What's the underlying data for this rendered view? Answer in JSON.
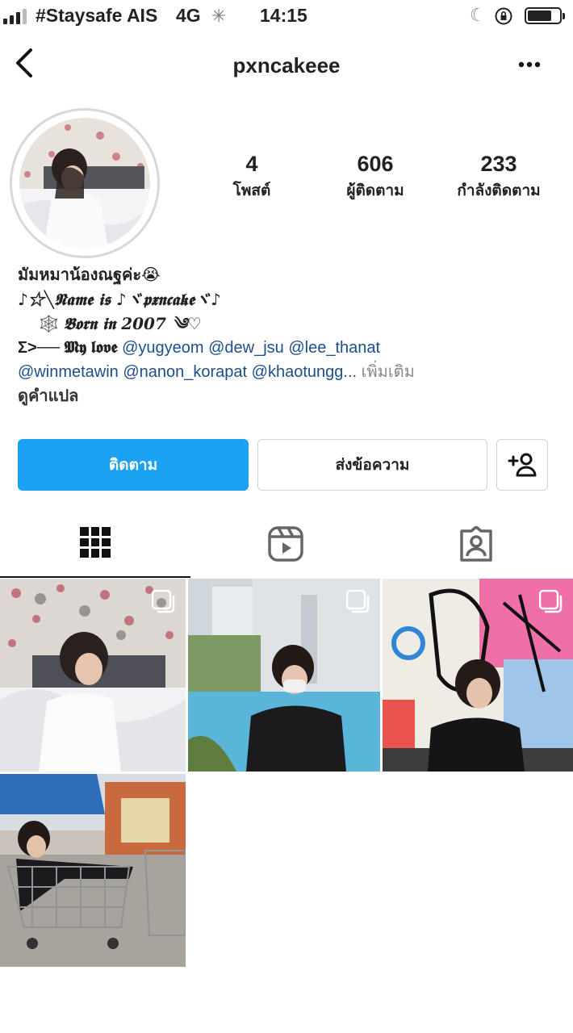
{
  "status_bar": {
    "carrier": "#Staysafe AIS",
    "network": "4G",
    "time": "14:15"
  },
  "nav": {
    "username": "pxncakeee"
  },
  "stats": {
    "posts": {
      "count": "4",
      "label": "โพสต์"
    },
    "followers": {
      "count": "606",
      "label": "ผู้ติดตาม"
    },
    "following": {
      "count": "233",
      "label": "กำลังติดตาม"
    }
  },
  "bio": {
    "line1": "มัมหมาน้องณฐค่ะ😭",
    "line2": "♪☆╲𝕹𝖆𝖒𝖊 𝖎𝖘 ♪ヾ𝖕𝖝𝖓𝖈𝖆𝖐𝖊ヾ♪",
    "line3_icon": "🕸️",
    "line3": "𝕭𝖔𝖗𝖓 𝖎𝖓 2007 ༄♡",
    "line4_prefix": "Σ>── 𝕸𝖞 𝖑𝖔𝖛𝖊",
    "mentions_line4": [
      "@yugyeom",
      "@dew_jsu",
      "@lee_thanat"
    ],
    "mentions_line5": [
      "@winmetawin",
      "@nanon_korapat",
      "@khaotungg..."
    ],
    "more_label": "เพิ่มเติม",
    "translate_label": "ดูคำแปล"
  },
  "buttons": {
    "follow": "ติดตาม",
    "message": "ส่งข้อความ"
  },
  "tabs": [
    {
      "name": "grid",
      "icon": "grid-icon",
      "active": true
    },
    {
      "name": "reels",
      "icon": "reels-icon",
      "active": false
    },
    {
      "name": "tagged",
      "icon": "tagged-icon",
      "active": false
    }
  ],
  "colors": {
    "follow_button": "#1ba1f2",
    "mention": "#1c4f8a"
  }
}
